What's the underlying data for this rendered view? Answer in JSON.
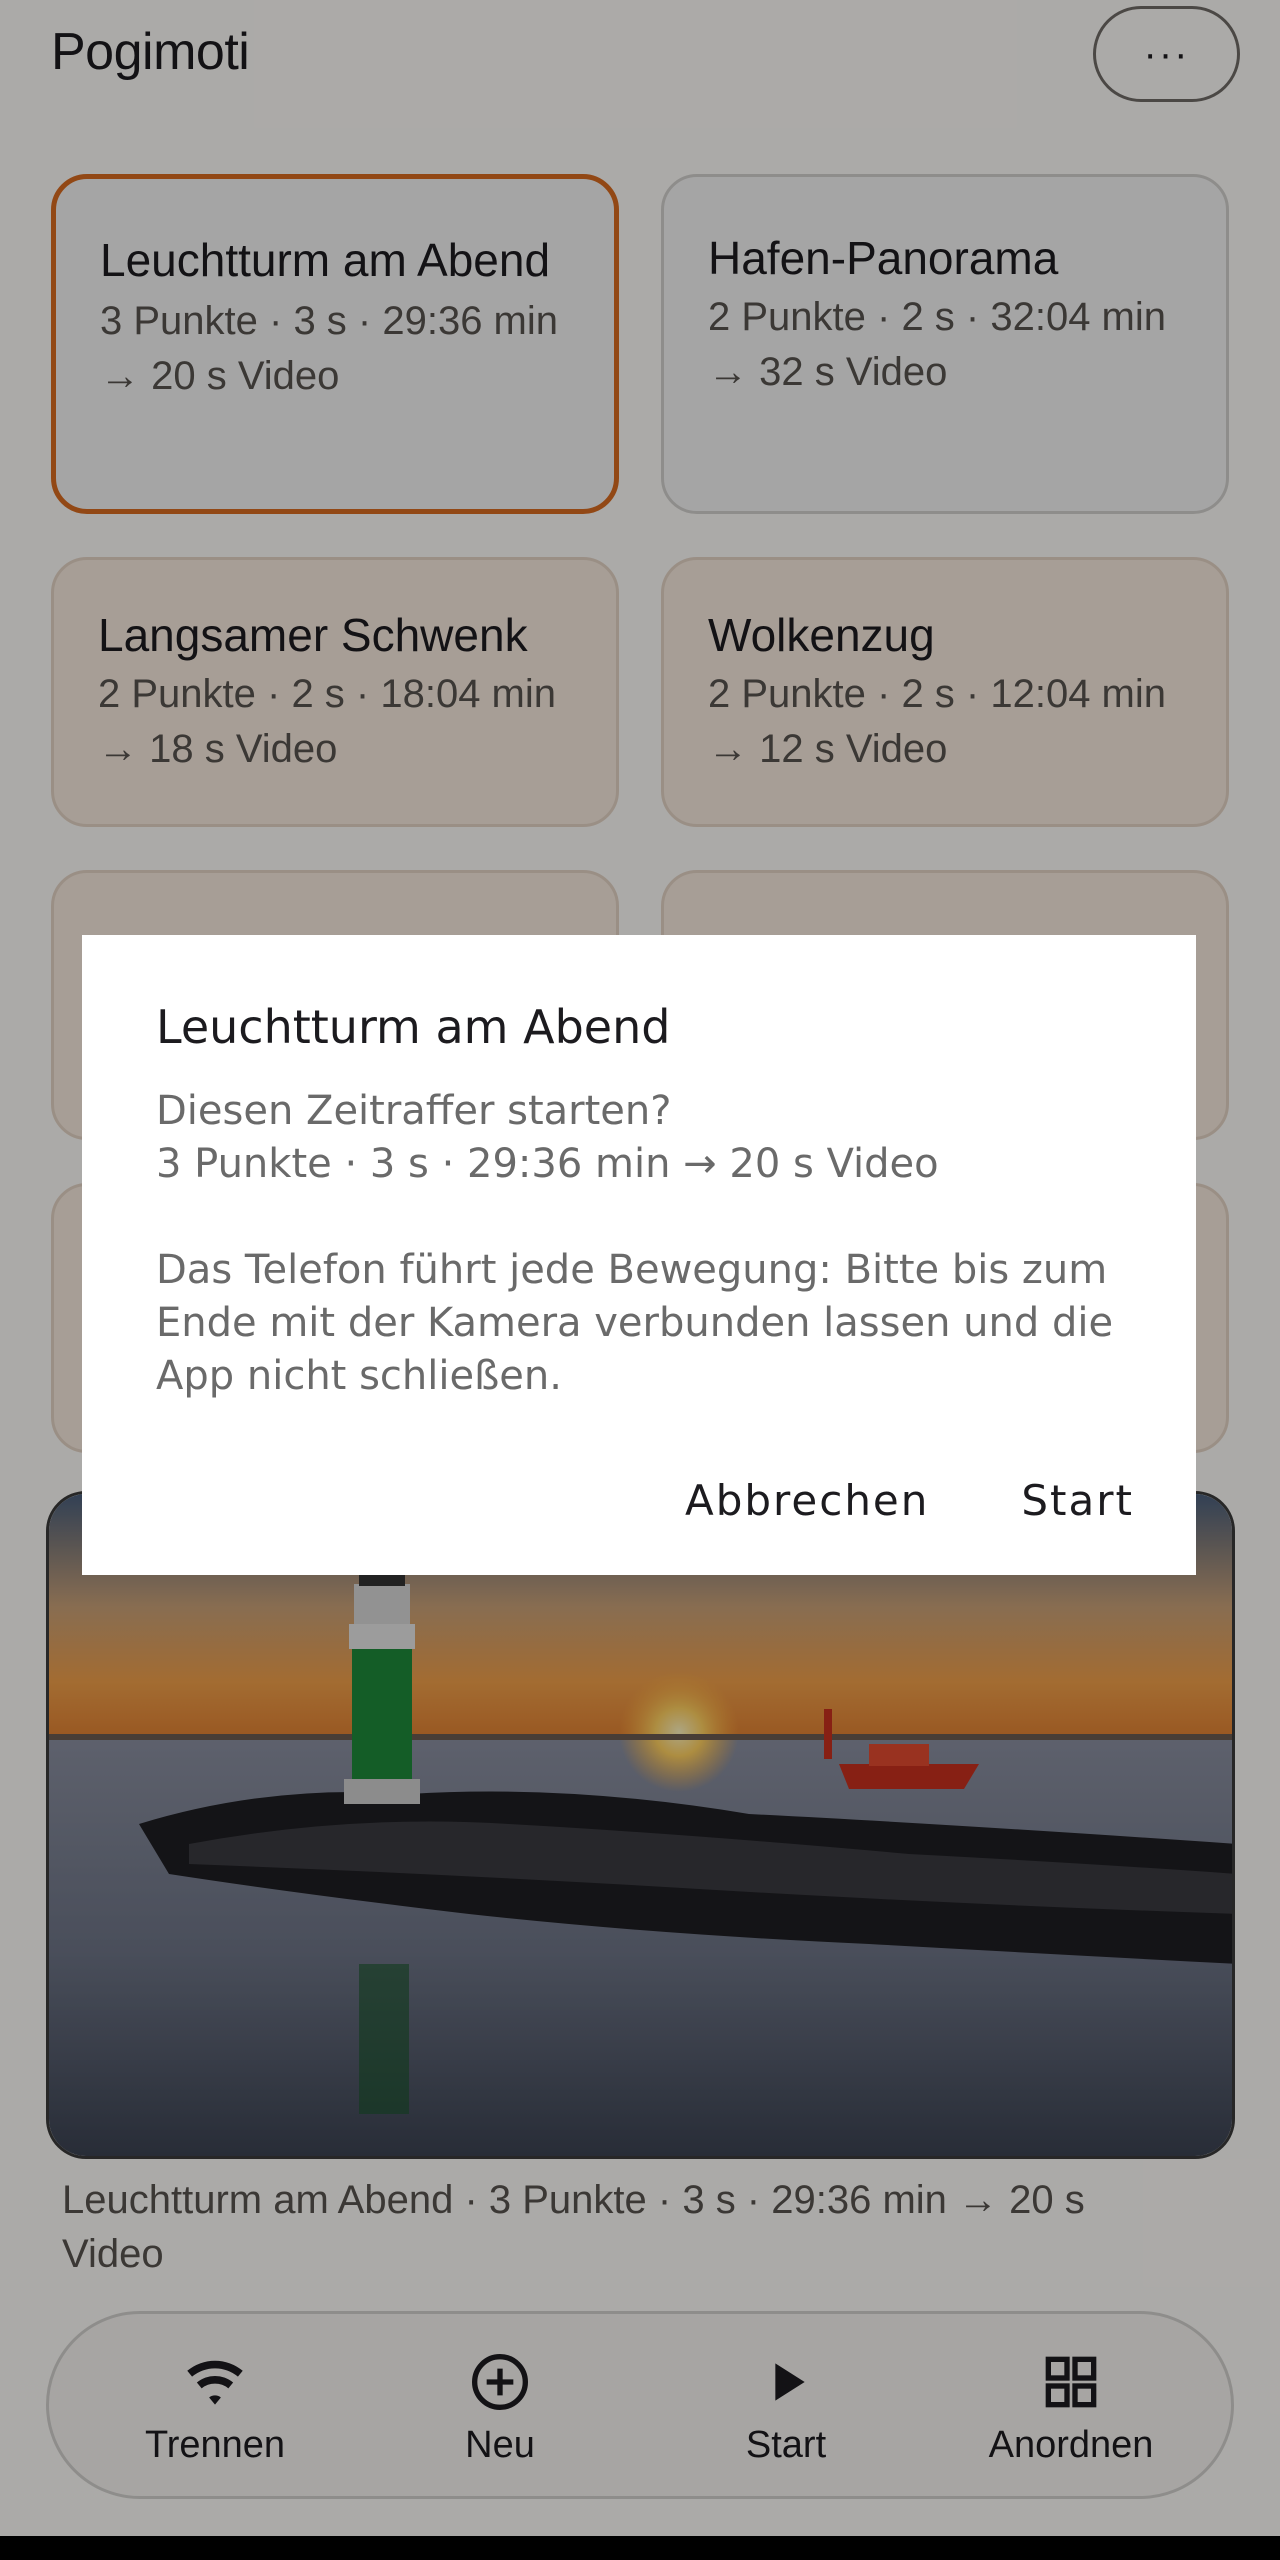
{
  "app": {
    "title": "Pogimoti",
    "more_label": "···"
  },
  "presets": [
    {
      "name": "Leuchtturm am Abend",
      "meta": "3 Punkte · 3 s · 29:36 min",
      "video": "→ 20 s Video"
    },
    {
      "name": "Hafen-Panorama",
      "meta": "2 Punkte · 2 s · 32:04 min",
      "video": "→ 32 s Video"
    },
    {
      "name": "Langsamer Schwenk",
      "meta": "2 Punkte · 2 s · 18:04 min",
      "video": "→ 18 s Video"
    },
    {
      "name": "Wolkenzug",
      "meta": "2 Punkte · 2 s · 12:04 min",
      "video": "→ 12 s Video"
    }
  ],
  "caption": "Leuchtturm am Abend  ·  3 Punkte · 3 s · 29:36 min → 20 s Video",
  "nav": {
    "disconnect": "Trennen",
    "new": "Neu",
    "start": "Start",
    "arrange": "Anordnen"
  },
  "dialog": {
    "title": "Leuchtturm am Abend",
    "question": "Diesen Zeitraffer starten?",
    "summary": "3 Punkte · 3 s · 29:36 min → 20 s Video",
    "warning": "Das Telefon führt jede Bewegung: Bitte bis zum Ende mit der Kamera verbunden lassen und die App nicht schließen.",
    "cancel_label": "Abbrechen",
    "start_label": "Start"
  },
  "colors": {
    "accent": "#d76b20",
    "warm_card": "#f6e9de",
    "scrim": "rgba(0,0,0,0.32)"
  },
  "icons": {
    "disconnect": "wifi-icon",
    "new": "add-circle-icon",
    "start": "play-icon",
    "arrange": "grid-icon"
  }
}
